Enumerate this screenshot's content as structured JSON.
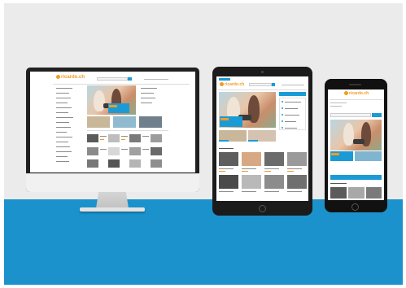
{
  "brand": {
    "name": "ricardo.ch",
    "color_orange": "#f29a23",
    "color_blue": "#1b9bd6"
  },
  "scene": {
    "wall_color": "#ebebeb",
    "floor_color": "#1b92cc"
  },
  "devices": [
    "desktop",
    "tablet",
    "phone"
  ]
}
